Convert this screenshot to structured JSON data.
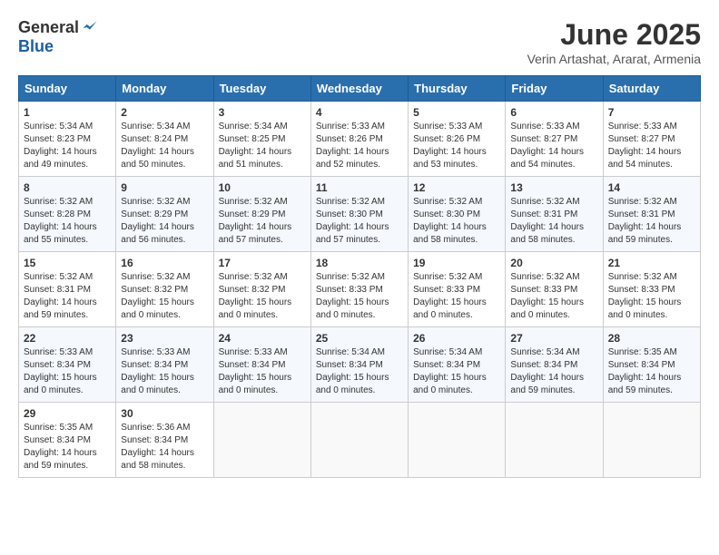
{
  "logo": {
    "general": "General",
    "blue": "Blue"
  },
  "title": "June 2025",
  "subtitle": "Verin Artashat, Ararat, Armenia",
  "weekdays": [
    "Sunday",
    "Monday",
    "Tuesday",
    "Wednesday",
    "Thursday",
    "Friday",
    "Saturday"
  ],
  "weeks": [
    [
      {
        "day": "1",
        "sunrise": "5:34 AM",
        "sunset": "8:23 PM",
        "daylight": "14 hours and 49 minutes."
      },
      {
        "day": "2",
        "sunrise": "5:34 AM",
        "sunset": "8:24 PM",
        "daylight": "14 hours and 50 minutes."
      },
      {
        "day": "3",
        "sunrise": "5:34 AM",
        "sunset": "8:25 PM",
        "daylight": "14 hours and 51 minutes."
      },
      {
        "day": "4",
        "sunrise": "5:33 AM",
        "sunset": "8:26 PM",
        "daylight": "14 hours and 52 minutes."
      },
      {
        "day": "5",
        "sunrise": "5:33 AM",
        "sunset": "8:26 PM",
        "daylight": "14 hours and 53 minutes."
      },
      {
        "day": "6",
        "sunrise": "5:33 AM",
        "sunset": "8:27 PM",
        "daylight": "14 hours and 54 minutes."
      },
      {
        "day": "7",
        "sunrise": "5:33 AM",
        "sunset": "8:27 PM",
        "daylight": "14 hours and 54 minutes."
      }
    ],
    [
      {
        "day": "8",
        "sunrise": "5:32 AM",
        "sunset": "8:28 PM",
        "daylight": "14 hours and 55 minutes."
      },
      {
        "day": "9",
        "sunrise": "5:32 AM",
        "sunset": "8:29 PM",
        "daylight": "14 hours and 56 minutes."
      },
      {
        "day": "10",
        "sunrise": "5:32 AM",
        "sunset": "8:29 PM",
        "daylight": "14 hours and 57 minutes."
      },
      {
        "day": "11",
        "sunrise": "5:32 AM",
        "sunset": "8:30 PM",
        "daylight": "14 hours and 57 minutes."
      },
      {
        "day": "12",
        "sunrise": "5:32 AM",
        "sunset": "8:30 PM",
        "daylight": "14 hours and 58 minutes."
      },
      {
        "day": "13",
        "sunrise": "5:32 AM",
        "sunset": "8:31 PM",
        "daylight": "14 hours and 58 minutes."
      },
      {
        "day": "14",
        "sunrise": "5:32 AM",
        "sunset": "8:31 PM",
        "daylight": "14 hours and 59 minutes."
      }
    ],
    [
      {
        "day": "15",
        "sunrise": "5:32 AM",
        "sunset": "8:31 PM",
        "daylight": "14 hours and 59 minutes."
      },
      {
        "day": "16",
        "sunrise": "5:32 AM",
        "sunset": "8:32 PM",
        "daylight": "15 hours and 0 minutes."
      },
      {
        "day": "17",
        "sunrise": "5:32 AM",
        "sunset": "8:32 PM",
        "daylight": "15 hours and 0 minutes."
      },
      {
        "day": "18",
        "sunrise": "5:32 AM",
        "sunset": "8:33 PM",
        "daylight": "15 hours and 0 minutes."
      },
      {
        "day": "19",
        "sunrise": "5:32 AM",
        "sunset": "8:33 PM",
        "daylight": "15 hours and 0 minutes."
      },
      {
        "day": "20",
        "sunrise": "5:32 AM",
        "sunset": "8:33 PM",
        "daylight": "15 hours and 0 minutes."
      },
      {
        "day": "21",
        "sunrise": "5:32 AM",
        "sunset": "8:33 PM",
        "daylight": "15 hours and 0 minutes."
      }
    ],
    [
      {
        "day": "22",
        "sunrise": "5:33 AM",
        "sunset": "8:34 PM",
        "daylight": "15 hours and 0 minutes."
      },
      {
        "day": "23",
        "sunrise": "5:33 AM",
        "sunset": "8:34 PM",
        "daylight": "15 hours and 0 minutes."
      },
      {
        "day": "24",
        "sunrise": "5:33 AM",
        "sunset": "8:34 PM",
        "daylight": "15 hours and 0 minutes."
      },
      {
        "day": "25",
        "sunrise": "5:34 AM",
        "sunset": "8:34 PM",
        "daylight": "15 hours and 0 minutes."
      },
      {
        "day": "26",
        "sunrise": "5:34 AM",
        "sunset": "8:34 PM",
        "daylight": "15 hours and 0 minutes."
      },
      {
        "day": "27",
        "sunrise": "5:34 AM",
        "sunset": "8:34 PM",
        "daylight": "14 hours and 59 minutes."
      },
      {
        "day": "28",
        "sunrise": "5:35 AM",
        "sunset": "8:34 PM",
        "daylight": "14 hours and 59 minutes."
      }
    ],
    [
      {
        "day": "29",
        "sunrise": "5:35 AM",
        "sunset": "8:34 PM",
        "daylight": "14 hours and 59 minutes."
      },
      {
        "day": "30",
        "sunrise": "5:36 AM",
        "sunset": "8:34 PM",
        "daylight": "14 hours and 58 minutes."
      },
      null,
      null,
      null,
      null,
      null
    ]
  ]
}
